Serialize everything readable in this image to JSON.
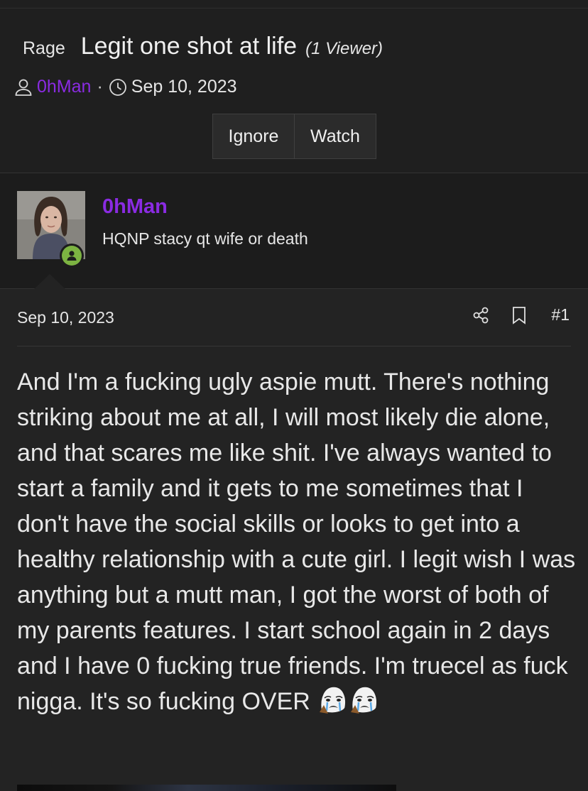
{
  "thread": {
    "prefix": "Rage",
    "title": "Legit one shot at life",
    "viewers": "(1 Viewer)",
    "author": "0hMan",
    "separator": "·",
    "date": "Sep 10, 2023"
  },
  "actions": {
    "ignore_label": "Ignore",
    "watch_label": "Watch"
  },
  "profile": {
    "username": "0hMan",
    "user_title": "HQNP stacy qt wife or death",
    "online": true
  },
  "post": {
    "date": "Sep 10, 2023",
    "number": "#1",
    "body": "And I'm a fucking ugly aspie mutt. There's nothing striking about me at all, I will most likely die alone, and that scares me like shit. I've always wanted to start a family and it gets to me sometimes that I don't have the social skills or looks to get into a healthy relationship with a cute girl. I legit wish I was anything but a mutt man, I got the worst of both of my parents features. I start school again in 2 days and I have 0 fucking true friends. I'm truecel as fuck nigga. It's so fucking OVER",
    "emojis": [
      "crying-face-emoji",
      "crying-face-emoji"
    ]
  },
  "colors": {
    "background": "#1f1f1f",
    "accent": "#8a2be2",
    "online": "#7cb342"
  }
}
